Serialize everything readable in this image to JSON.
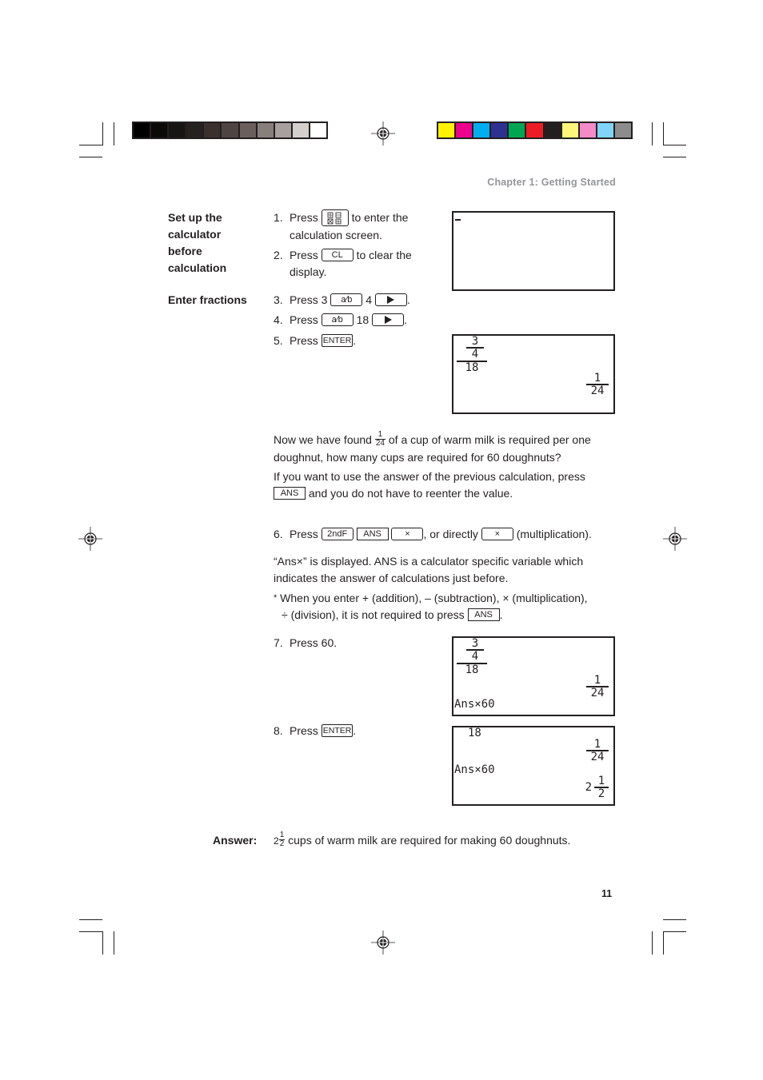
{
  "print_marks": {
    "grayscale_bar": [
      "#000000",
      "#0c0a09",
      "#171414",
      "#25211f",
      "#3a302e",
      "#4e4543",
      "#6a5f5c",
      "#887e7c",
      "#a8a09e",
      "#d4cfcd",
      "#ffffff"
    ],
    "color_bar": [
      "#fff200",
      "#ec008c",
      "#00aeef",
      "#2e3192",
      "#00a651",
      "#ed1c24",
      "#231f20",
      "#fff57a",
      "#f58ac8",
      "#7fd4f8",
      "#8c8c8c"
    ],
    "registration_icon": "crosshair-target-icon"
  },
  "header": {
    "chapter": "Chapter 1: Getting Started"
  },
  "sections": {
    "setup_title": [
      "Set up the",
      "calculator",
      "before",
      "calculation"
    ],
    "fractions_title": "Enter fractions"
  },
  "keys": {
    "menu": "menu-grid-icon",
    "cl": "CL",
    "ab": "a⁄b",
    "right": "right-arrow-icon",
    "enter": "ENTER",
    "ans": "ANS",
    "second": "2ndF",
    "times": "×"
  },
  "steps": [
    {
      "num": "1.",
      "pre": "Press",
      "post": "to enter the",
      "cont": "calculation screen."
    },
    {
      "num": "2.",
      "pre": "Press",
      "post": "to clear the",
      "cont": "display."
    },
    {
      "num": "3.",
      "pre": "Press 3",
      "mid": "4",
      "post": "."
    },
    {
      "num": "4.",
      "pre": "Press",
      "mid": "18",
      "post": "."
    },
    {
      "num": "5.",
      "pre": "Press",
      "post": "."
    },
    {
      "num": "6.",
      "pre": "Press",
      "mid": ", or directly",
      "post": "(multiplication)."
    },
    {
      "num": "7.",
      "pre": "Press 60."
    },
    {
      "num": "8.",
      "pre": "Press",
      "post": "."
    }
  ],
  "paragraphs": {
    "found_pre": "Now we have found",
    "found_frac": {
      "n": "1",
      "d": "24"
    },
    "found_post": "of a cup of warm milk is required per one",
    "found_line2": "doughnut, how many cups are required for 60 doughnuts?",
    "ans_line1": "If you want to use the answer of the previous calculation, press",
    "ans_line2": "and you do not have to reenter the value.",
    "ansx_line1": "“Ans×” is displayed. ANS is a calculator specific variable which",
    "ansx_line2": "indicates the answer of calculations just before.",
    "note_star": "*",
    "note_line1": "When you enter + (addition), – (subtraction), × (multiplication),",
    "note_line2_pre": "÷ (division), it is not required to press",
    "note_line2_post": "."
  },
  "screens": {
    "s1": {
      "cursor": "_"
    },
    "s2": {
      "expr_num": "3",
      "expr_den": "4",
      "expr_outer_den": "18",
      "result_n": "1",
      "result_d": "24"
    },
    "s3": {
      "expr_num": "3",
      "expr_den": "4",
      "expr_outer_den": "18",
      "result_n": "1",
      "result_d": "24",
      "input": "Ans×60"
    },
    "s4": {
      "top": "18",
      "result_n": "1",
      "result_d": "24",
      "input": "Ans×60",
      "ans_whole": "2",
      "ans_n": "1",
      "ans_d": "2"
    }
  },
  "answer": {
    "label": "Answer:",
    "whole": "2",
    "n": "1",
    "d": "2",
    "text": "cups of warm milk are required for making 60 doughnuts."
  },
  "page_number": "11"
}
